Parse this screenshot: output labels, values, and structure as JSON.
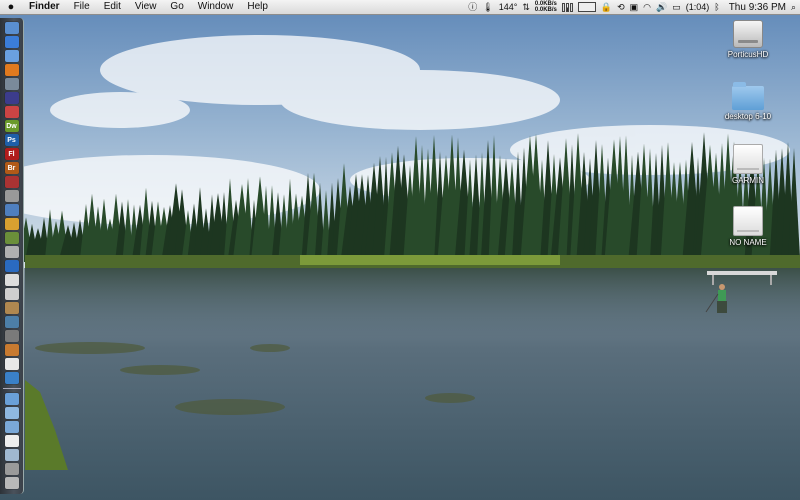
{
  "menubar": {
    "apple_icon": "apple-logo-icon",
    "app_name": "Finder",
    "items": [
      "File",
      "Edit",
      "View",
      "Go",
      "Window",
      "Help"
    ]
  },
  "status": {
    "temperature": "144°",
    "net_up": "0.0KB/s",
    "net_down": "0.0KB/s",
    "battery_time": "(1:04)",
    "clock": "Thu 9:36 PM",
    "icons": [
      "info-icon",
      "thermometer-icon",
      "network-monitor-icon",
      "cpu-bars-icon",
      "memory-meter-icon",
      "lock-icon",
      "time-machine-icon",
      "script-icon",
      "wifi-icon",
      "volume-icon",
      "battery-icon",
      "bluetooth-icon",
      "spotlight-icon"
    ]
  },
  "dock": {
    "apps": [
      {
        "name": "finder",
        "color": "#5a8fd0",
        "text": ""
      },
      {
        "name": "safari",
        "color": "#3b7dd8",
        "text": ""
      },
      {
        "name": "ichat",
        "color": "#6aa0e0",
        "text": ""
      },
      {
        "name": "firefox",
        "color": "#e07a1f",
        "text": ""
      },
      {
        "name": "mail",
        "color": "#7a8a9a",
        "text": ""
      },
      {
        "name": "itunes",
        "color": "#3c3c8c",
        "text": ""
      },
      {
        "name": "addressbook",
        "color": "#c44",
        "text": ""
      },
      {
        "name": "dreamweaver",
        "color": "#6a9a2a",
        "text": "Dw"
      },
      {
        "name": "photoshop",
        "color": "#1f5fa8",
        "text": "Ps"
      },
      {
        "name": "flash",
        "color": "#b01c1c",
        "text": "Fl"
      },
      {
        "name": "bridge",
        "color": "#b05a18",
        "text": "Br"
      },
      {
        "name": "photo-booth",
        "color": "#aa3333",
        "text": ""
      },
      {
        "name": "preview",
        "color": "#999999",
        "text": ""
      },
      {
        "name": "app-14",
        "color": "#4f7fbf",
        "text": ""
      },
      {
        "name": "app-15",
        "color": "#d9a030",
        "text": ""
      },
      {
        "name": "app-16",
        "color": "#6b8f3a",
        "text": ""
      },
      {
        "name": "app-17",
        "color": "#b0b0b0",
        "text": ""
      },
      {
        "name": "app-18",
        "color": "#2a6ac0",
        "text": ""
      },
      {
        "name": "calendar",
        "color": "#dddddd",
        "text": ""
      },
      {
        "name": "app-20",
        "color": "#cfcfcf",
        "text": ""
      },
      {
        "name": "app-21",
        "color": "#b08850",
        "text": ""
      },
      {
        "name": "app-22",
        "color": "#4d7fa8",
        "text": ""
      },
      {
        "name": "app-23",
        "color": "#7a7a7a",
        "text": ""
      },
      {
        "name": "app-24",
        "color": "#c87a30",
        "text": ""
      },
      {
        "name": "app-25",
        "color": "#e8e8e8",
        "text": ""
      },
      {
        "name": "app-26",
        "color": "#3a80c8",
        "text": ""
      }
    ],
    "stacks": [
      {
        "name": "applications-stack",
        "color": "#6aa0d8"
      },
      {
        "name": "documents-stack",
        "color": "#8fb8e0"
      },
      {
        "name": "downloads-stack",
        "color": "#7aa8d8"
      },
      {
        "name": "file-stack",
        "color": "#eeeeee"
      },
      {
        "name": "folder-stack",
        "color": "#a0b8d0"
      },
      {
        "name": "picture-stack",
        "color": "#9a9a9a"
      },
      {
        "name": "trash",
        "color": "#b8b8b8"
      }
    ]
  },
  "desktop_icons": [
    {
      "label": "PorticusHD",
      "kind": "drive"
    },
    {
      "label": "desktop 6-10",
      "kind": "folder"
    },
    {
      "label": "GARMIN",
      "kind": "white-drive"
    },
    {
      "label": "NO NAME",
      "kind": "white-drive"
    }
  ]
}
